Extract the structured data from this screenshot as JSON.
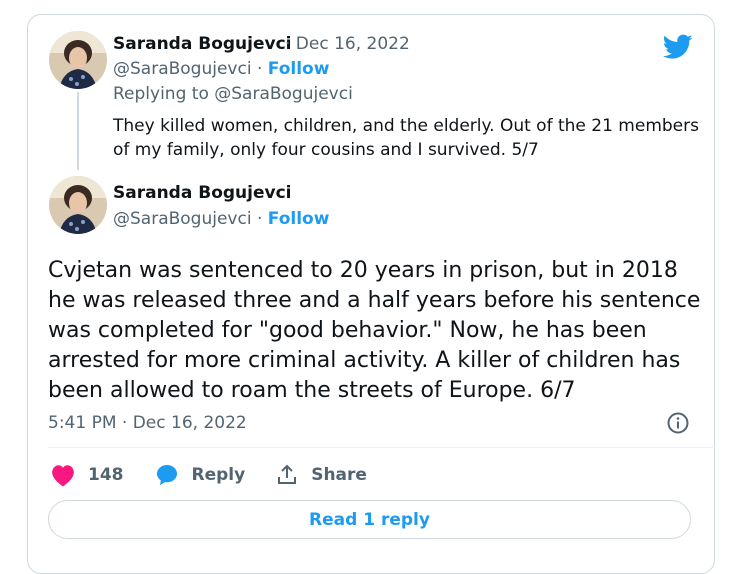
{
  "first_tweet": {
    "author_name": "Saranda Bogujevci",
    "date": "· Dec 16, 2022",
    "handle": "@SaraBogujevci",
    "separator": "·",
    "follow_label": "Follow",
    "replying_to": "Replying to @SaraBogujevci",
    "text": "They killed women, children, and the elderly. Out of the 21 members of my family, only four cousins and I survived. 5/7"
  },
  "main_tweet": {
    "author_name": "Saranda Bogujevci",
    "handle": "@SaraBogujevci",
    "separator": "·",
    "follow_label": "Follow",
    "text": "Cvjetan was sentenced to 20 years in prison, but in 2018 he was released three and a half years before his sentence was completed for \"good behavior.\" Now, he has been arrested for more criminal activity. A killer of children has been allowed to roam the streets of Europe. 6/7",
    "timestamp": "5:41 PM · Dec 16, 2022"
  },
  "actions": {
    "like_count": "148",
    "reply_label": "Reply",
    "share_label": "Share"
  },
  "read_replies_label": "Read 1 reply",
  "icons": [
    "twitter-bird-icon",
    "info-icon",
    "heart-icon",
    "reply-bubble-icon",
    "share-icon"
  ],
  "colors": {
    "accent": "#1d9bf0",
    "like": "#f91880",
    "muted": "#536471"
  }
}
